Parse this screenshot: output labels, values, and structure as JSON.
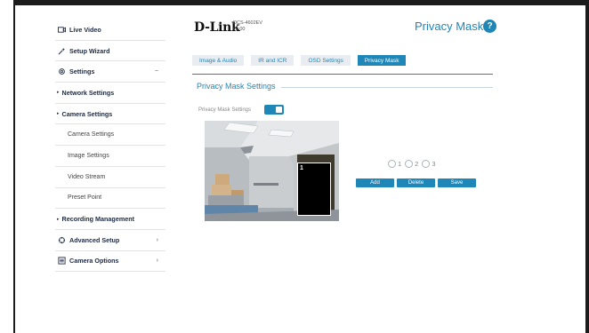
{
  "sidebar": {
    "items": [
      {
        "label": "Live Video",
        "icon": "video-icon"
      },
      {
        "label": "Setup Wizard",
        "icon": "wand-icon"
      },
      {
        "label": "Settings",
        "icon": "gear-icon",
        "right": "−"
      },
      {
        "label": "Network Settings"
      },
      {
        "label": "Camera Settings"
      },
      {
        "label": "Camera Settings"
      },
      {
        "label": "Image Settings"
      },
      {
        "label": "Video Stream"
      },
      {
        "label": "Preset Point"
      },
      {
        "label": "Recording Management"
      },
      {
        "label": "Advanced Setup",
        "icon": "advanced-gear-icon",
        "right": "›"
      },
      {
        "label": "Camera Options",
        "icon": "camera-options-icon",
        "right": "›"
      }
    ]
  },
  "header": {
    "logo": "D-Link",
    "model": "DCS-4602EV",
    "version": "v2.00",
    "page_title": "Privacy Mask",
    "help_icon": "?"
  },
  "tabs": [
    {
      "label": "Image & Audio",
      "active": false
    },
    {
      "label": "IR and ICR",
      "active": false
    },
    {
      "label": "OSD Settings",
      "active": false
    },
    {
      "label": "Privacy Mask",
      "active": true
    }
  ],
  "section": {
    "title": "Privacy Mask Settings",
    "toggle_label": "Privacy Mask Settings",
    "toggle_on": true
  },
  "camera": {
    "mask_label": "1"
  },
  "radios": [
    {
      "label": "1"
    },
    {
      "label": "2"
    },
    {
      "label": "3"
    }
  ],
  "buttons": {
    "add": "Add",
    "delete": "Delete",
    "save": "Save"
  },
  "colors": {
    "accent": "#1f86b8",
    "tab_bg": "#e9edf1",
    "text": "#1d2a44"
  }
}
